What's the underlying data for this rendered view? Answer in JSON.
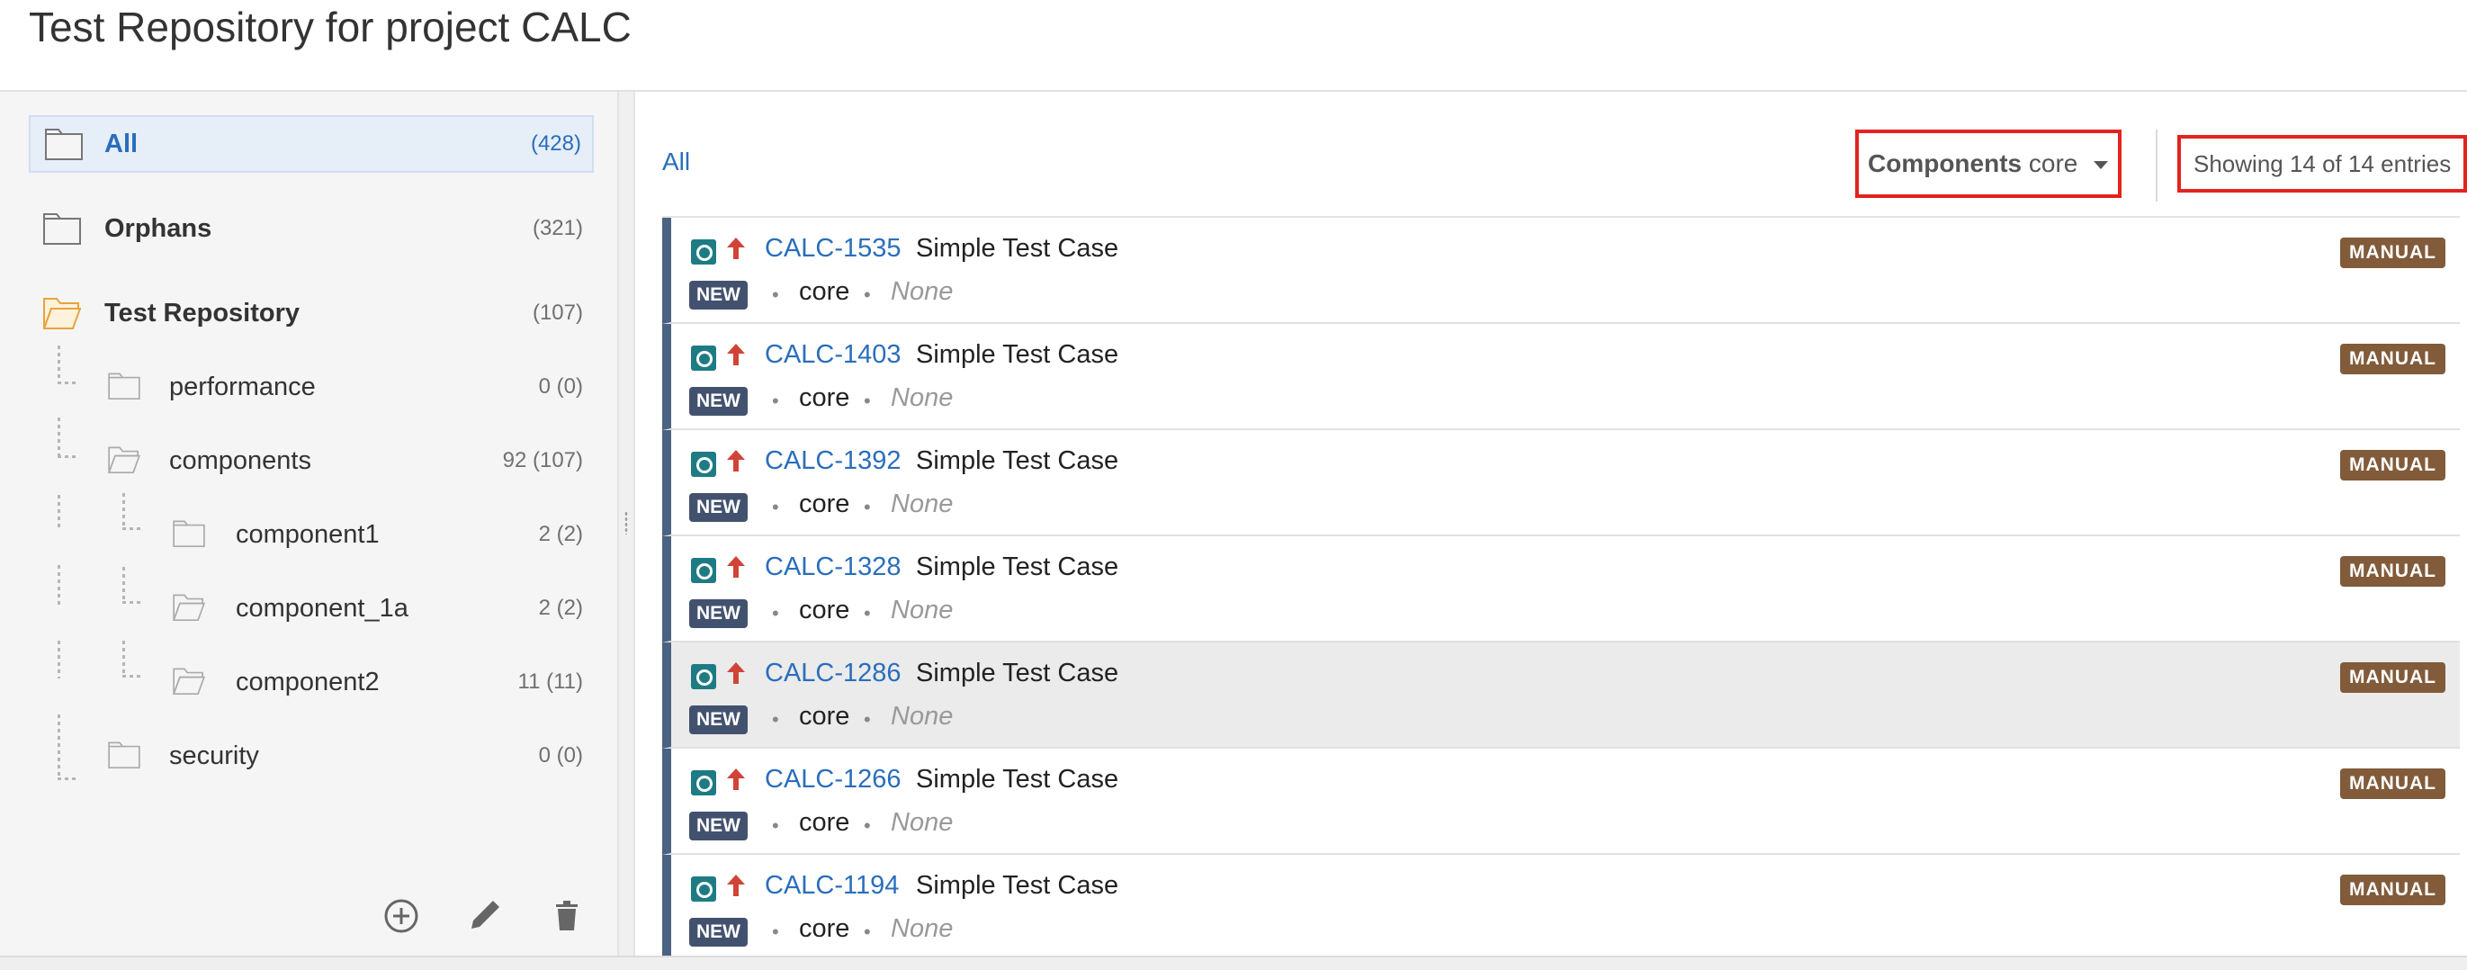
{
  "page": {
    "title": "Test Repository for project CALC"
  },
  "tree": {
    "all": {
      "label": "All",
      "count": "(428)"
    },
    "orphans": {
      "label": "Orphans",
      "count": "(321)"
    },
    "repository": {
      "label": "Test Repository",
      "count": "(107)"
    },
    "folders": [
      {
        "label": "performance",
        "count": "0 (0)"
      },
      {
        "label": "components",
        "count": "92 (107)"
      },
      {
        "label": "component1",
        "count": "2 (2)"
      },
      {
        "label": "component_1a",
        "count": "2 (2)"
      },
      {
        "label": "component2",
        "count": "11 (11)"
      },
      {
        "label": "security",
        "count": "0 (0)"
      }
    ]
  },
  "sidebar_footer": {
    "icons": [
      "add-folder-icon",
      "edit-icon",
      "delete-icon"
    ]
  },
  "toolbar": {
    "breadcrumb": "All",
    "filter_key": "Components",
    "filter_value": "core",
    "entries_text": "Showing 14 of 14 entries"
  },
  "colors": {
    "link": "#2a6ebb",
    "highlight_border": "#e3231d",
    "manual_badge": "#815b3a",
    "status_badge": "#42526e",
    "test_icon": "#1e7b83",
    "priority_icon": "#d04437"
  },
  "tests": [
    {
      "key": "CALC-1535",
      "summary": "Simple Test Case",
      "status": "NEW",
      "component": "core",
      "fix_version": "None",
      "type": "MANUAL"
    },
    {
      "key": "CALC-1403",
      "summary": "Simple Test Case",
      "status": "NEW",
      "component": "core",
      "fix_version": "None",
      "type": "MANUAL"
    },
    {
      "key": "CALC-1392",
      "summary": "Simple Test Case",
      "status": "NEW",
      "component": "core",
      "fix_version": "None",
      "type": "MANUAL"
    },
    {
      "key": "CALC-1328",
      "summary": "Simple Test Case",
      "status": "NEW",
      "component": "core",
      "fix_version": "None",
      "type": "MANUAL"
    },
    {
      "key": "CALC-1286",
      "summary": "Simple Test Case",
      "status": "NEW",
      "component": "core",
      "fix_version": "None",
      "type": "MANUAL"
    },
    {
      "key": "CALC-1266",
      "summary": "Simple Test Case",
      "status": "NEW",
      "component": "core",
      "fix_version": "None",
      "type": "MANUAL"
    },
    {
      "key": "CALC-1194",
      "summary": "Simple Test Case",
      "status": "NEW",
      "component": "core",
      "fix_version": "None",
      "type": "MANUAL"
    }
  ]
}
